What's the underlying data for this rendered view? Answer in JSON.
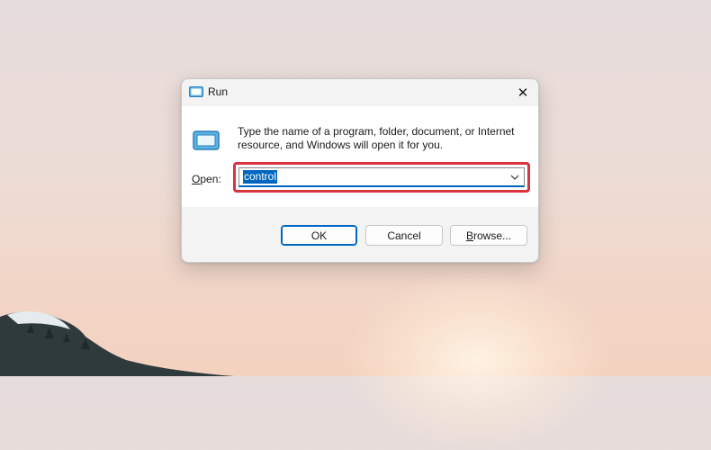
{
  "window": {
    "title": "Run",
    "close_icon": "close-icon",
    "app_icon": "run-icon"
  },
  "content": {
    "description_line1": "Type the name of a program, folder, document, or Internet",
    "description_line2": "resource, and Windows will open it for you.",
    "open_label_mnemonic": "O",
    "open_label_rest": "pen:",
    "open_value": "control",
    "dropdown_icon": "chevron-down-icon"
  },
  "buttons": {
    "ok": "OK",
    "cancel": "Cancel",
    "browse_mnemonic": "B",
    "browse_rest": "rowse..."
  },
  "colors": {
    "accent": "#0067c0",
    "highlight_box": "#d9343f"
  }
}
